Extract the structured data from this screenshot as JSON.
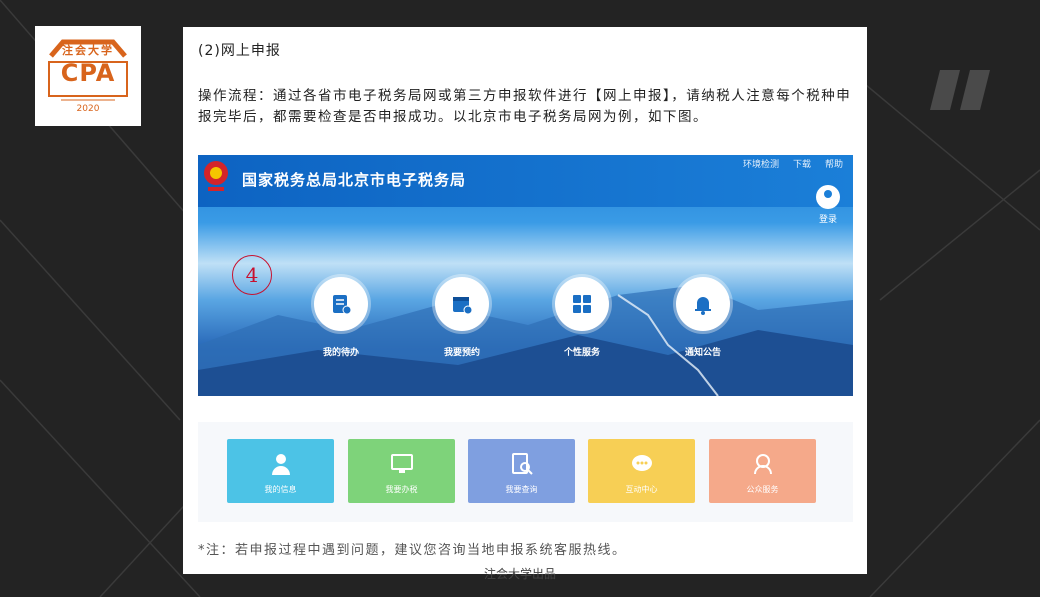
{
  "logo": {
    "motto": "注会大学",
    "mark": "CPA",
    "year": "2020"
  },
  "article": {
    "subtitle": "(2)网上申报",
    "paragraph": "操作流程：通过各省市电子税务局网或第三方申报软件进行【网上申报】，请纳税人注意每个税种申报完毕后，都需要检查是否申报成功。以北京市电子税务局网为例，如下图。",
    "note": "*注：若申报过程中遇到问题，建议您咨询当地申报系统客服热线。"
  },
  "screenshot": {
    "site_title": "国家税务总局北京市电子税务局",
    "toplinks": [
      "环境检测",
      "下载",
      "帮助"
    ],
    "login_label": "登录",
    "step_number": "4",
    "services": [
      {
        "label": "我的待办",
        "icon": "todo-list-icon"
      },
      {
        "label": "我要预约",
        "icon": "calendar-icon"
      },
      {
        "label": "个性服务",
        "icon": "grid-icon"
      },
      {
        "label": "通知公告",
        "icon": "bell-icon"
      }
    ],
    "tiles": [
      {
        "label": "我的信息",
        "icon": "person-icon",
        "color": "#4cc3e6"
      },
      {
        "label": "我要办税",
        "icon": "monitor-icon",
        "color": "#7ed37a"
      },
      {
        "label": "我要查询",
        "icon": "search-document-icon",
        "color": "#7f9fe0"
      },
      {
        "label": "互动中心",
        "icon": "chat-icon",
        "color": "#f7cf55"
      },
      {
        "label": "公众服务",
        "icon": "service-icon",
        "color": "#f5a98a"
      }
    ]
  },
  "credit": "注会大学出品",
  "colors": {
    "background": "#232323",
    "logo_orange": "#d8641c",
    "step_red": "#c8102e"
  }
}
